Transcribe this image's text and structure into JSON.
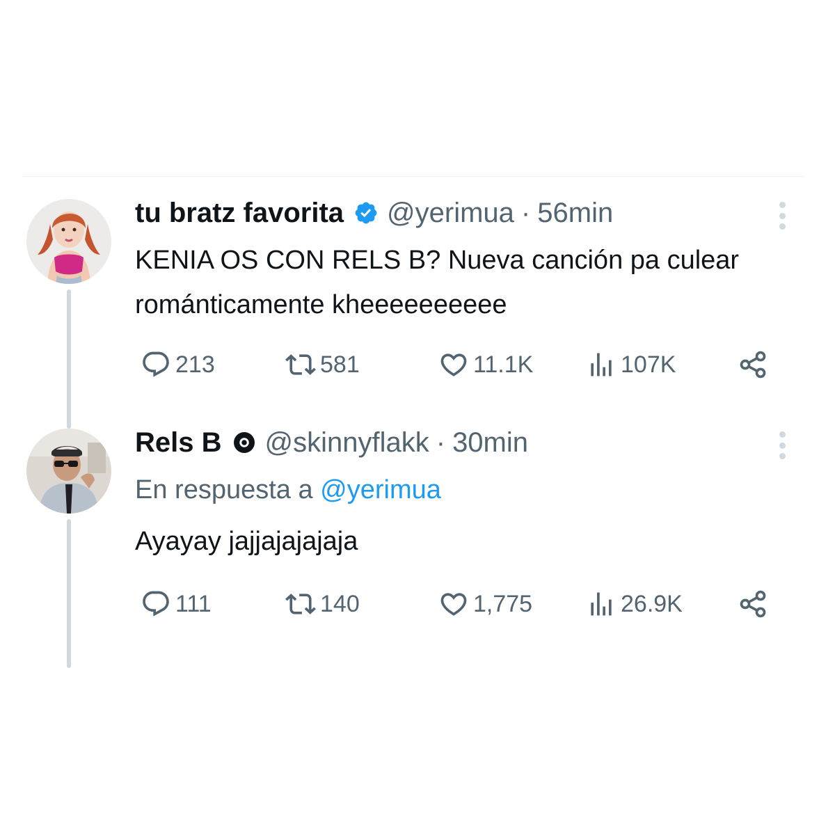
{
  "tweets": [
    {
      "display_name": "tu bratz favorita",
      "badge": "verified-badge-blue",
      "handle": "@yerimua",
      "separator": "·",
      "time": "56min",
      "text": "KENIA OS CON RELS B? Nueva canción pa culear románticamente kheeeeeeeeee",
      "stats": {
        "replies": "213",
        "retweets": "581",
        "likes": "11.1K",
        "views": "107K"
      }
    },
    {
      "display_name": "Rels B",
      "badge": "verified-badge-black",
      "handle": "@skinnyflakk",
      "separator": "·",
      "time": "30min",
      "reply_to_prefix": "En respuesta a",
      "reply_to_handle": "@yerimua",
      "text": "Ayayay jajjajajajaja",
      "stats": {
        "replies": "111",
        "retweets": "140",
        "likes": "1,775",
        "views": "26.9K"
      }
    }
  ],
  "colors": {
    "text_primary": "#0f1419",
    "text_secondary": "#536471",
    "link": "#1d9bf0",
    "thread_line": "#cfd9de",
    "verified_blue": "#1d9bf0"
  },
  "icons": [
    "reply-icon",
    "retweet-icon",
    "like-icon",
    "views-icon",
    "share-icon",
    "more-options-icon"
  ]
}
